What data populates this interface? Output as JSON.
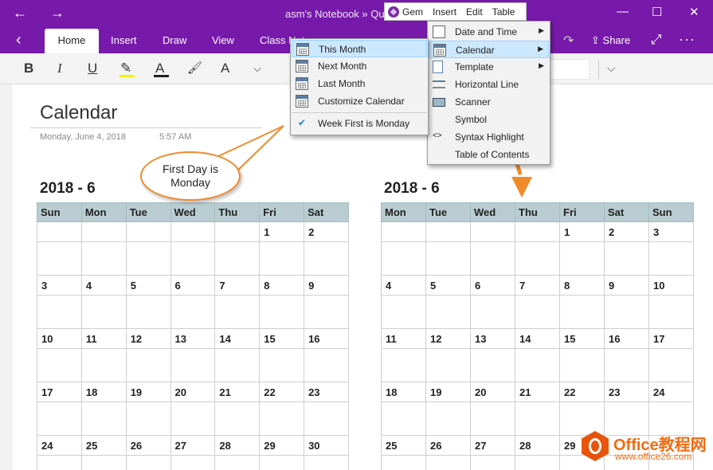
{
  "window": {
    "title": "asm's Notebook » Qu",
    "back_glyph": "←",
    "forward_glyph": "→",
    "minimize_glyph": "—",
    "maximize_glyph": "☐",
    "close_glyph": "✕"
  },
  "gem_bar": {
    "items": [
      "Gem",
      "Insert",
      "Edit",
      "Table"
    ]
  },
  "tabs": {
    "back_glyph": "‹",
    "items": [
      "Home",
      "Insert",
      "Draw",
      "View",
      "Class Note"
    ],
    "share_label": "Share",
    "share_glyph": "⇪",
    "redo_glyph": "↷",
    "expand_glyph": "⤢",
    "more_glyph": "···"
  },
  "ribbon": {
    "bold": "B",
    "italic": "I",
    "underline": "U",
    "highlight_glyph": "✎",
    "font_color": "A",
    "format_painter_glyph": "🖌",
    "clear_format": "A",
    "dropdown_glyph": "⌵",
    "right_dropdown_glyph": "⌵",
    "highlight_color": "#f3f000"
  },
  "page": {
    "title": "Calendar",
    "date": "Monday, June 4, 2018",
    "time": "5:57 AM"
  },
  "calendar_left": {
    "heading": "2018 - 6",
    "days": [
      "Sun",
      "Mon",
      "Tue",
      "Wed",
      "Thu",
      "Fri",
      "Sat"
    ],
    "weeks": [
      [
        "",
        "",
        "",
        "",
        "",
        "1",
        "2"
      ],
      [
        "3",
        "4",
        "5",
        "6",
        "7",
        "8",
        "9"
      ],
      [
        "10",
        "11",
        "12",
        "13",
        "14",
        "15",
        "16"
      ],
      [
        "17",
        "18",
        "19",
        "20",
        "21",
        "22",
        "23"
      ],
      [
        "24",
        "25",
        "26",
        "27",
        "28",
        "29",
        "30"
      ]
    ]
  },
  "calendar_right": {
    "heading": "2018 - 6",
    "days": [
      "Mon",
      "Tue",
      "Wed",
      "Thu",
      "Fri",
      "Sat",
      "Sun"
    ],
    "weeks": [
      [
        "",
        "",
        "",
        "",
        "1",
        "2",
        "3"
      ],
      [
        "4",
        "5",
        "6",
        "7",
        "8",
        "9",
        "10"
      ],
      [
        "11",
        "12",
        "13",
        "14",
        "15",
        "16",
        "17"
      ],
      [
        "18",
        "19",
        "20",
        "21",
        "22",
        "23",
        "24"
      ],
      [
        "25",
        "26",
        "27",
        "28",
        "29",
        "",
        ""
      ]
    ]
  },
  "insert_menu": {
    "items": [
      {
        "label": "Date and Time",
        "icon": "calendar-clock-icon",
        "submenu": true
      },
      {
        "label": "Calendar",
        "icon": "calendar-icon",
        "submenu": true,
        "selected": true
      },
      {
        "label": "Template",
        "icon": "template-icon",
        "submenu": true
      },
      {
        "label": "Horizontal Line",
        "icon": "horizontal-line-icon"
      },
      {
        "label": "Scanner",
        "icon": "scanner-icon"
      },
      {
        "label": "Symbol",
        "icon": ""
      },
      {
        "label": "Syntax Highlight",
        "icon": "code-icon",
        "glyph": "<>"
      },
      {
        "label": "Table of Contents",
        "icon": ""
      }
    ],
    "arrow_glyph": "▶"
  },
  "calendar_menu": {
    "items": [
      {
        "label": "This Month",
        "icon": "calendar-icon",
        "selected": true
      },
      {
        "label": "Next Month",
        "icon": "calendar-icon"
      },
      {
        "label": "Last Month",
        "icon": "calendar-icon"
      },
      {
        "label": "Customize Calendar",
        "icon": "calendar-icon"
      },
      {
        "label": "Week First is Monday",
        "icon": "check-icon",
        "checked": true
      }
    ],
    "check_glyph": "✔"
  },
  "callout": {
    "line1": "First Day is",
    "line2": "Monday"
  },
  "watermark": {
    "title": "Office教程网",
    "url": "www.office26.com"
  },
  "colors": {
    "brand": "#7719aa",
    "callout_border": "#ef8b2c",
    "header_fill": "#b8ccd1",
    "menu_highlight": "#cce8ff"
  }
}
